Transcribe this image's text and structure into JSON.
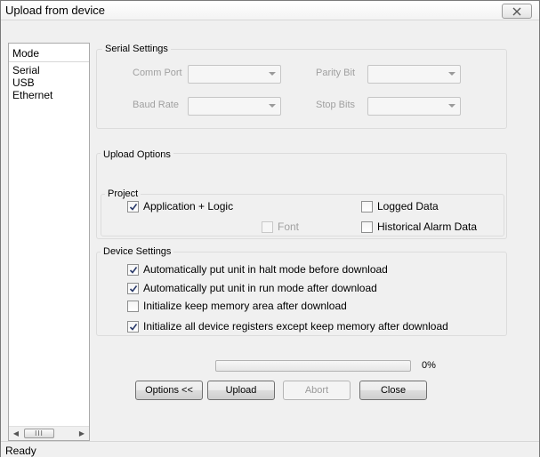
{
  "window": {
    "title": "Upload from device"
  },
  "mode_panel": {
    "header": "Mode",
    "items": [
      "Serial",
      "USB",
      "Ethernet"
    ],
    "scroll_thumb": "III"
  },
  "serial_settings": {
    "legend": "Serial Settings",
    "comm_port_label": "Comm Port",
    "baud_rate_label": "Baud Rate",
    "parity_bit_label": "Parity Bit",
    "stop_bits_label": "Stop Bits"
  },
  "upload_options": {
    "legend": "Upload Options",
    "project_legend": "Project",
    "application_logic": {
      "label": "Application + Logic",
      "checked": true
    },
    "font": {
      "label": "Font",
      "checked": false
    },
    "logged_data": {
      "label": "Logged Data",
      "checked": false
    },
    "historical_alarm": {
      "label": "Historical Alarm Data",
      "checked": false
    }
  },
  "device_settings": {
    "legend": "Device Settings",
    "items": [
      {
        "label": "Automatically put unit in halt mode before download",
        "checked": true
      },
      {
        "label": "Automatically put unit in run mode after download",
        "checked": true
      },
      {
        "label": "Initialize keep memory area after download",
        "checked": false
      },
      {
        "label": "Initialize all device registers except keep memory after download",
        "checked": true
      }
    ]
  },
  "progress": {
    "value": 0,
    "text": "0%"
  },
  "buttons": {
    "options": "Options <<",
    "upload": "Upload",
    "abort": "Abort",
    "close": "Close"
  },
  "status": {
    "text": "Ready"
  },
  "colors": {
    "progress_fill": "#06b025",
    "frame": "#f0f0f0"
  }
}
